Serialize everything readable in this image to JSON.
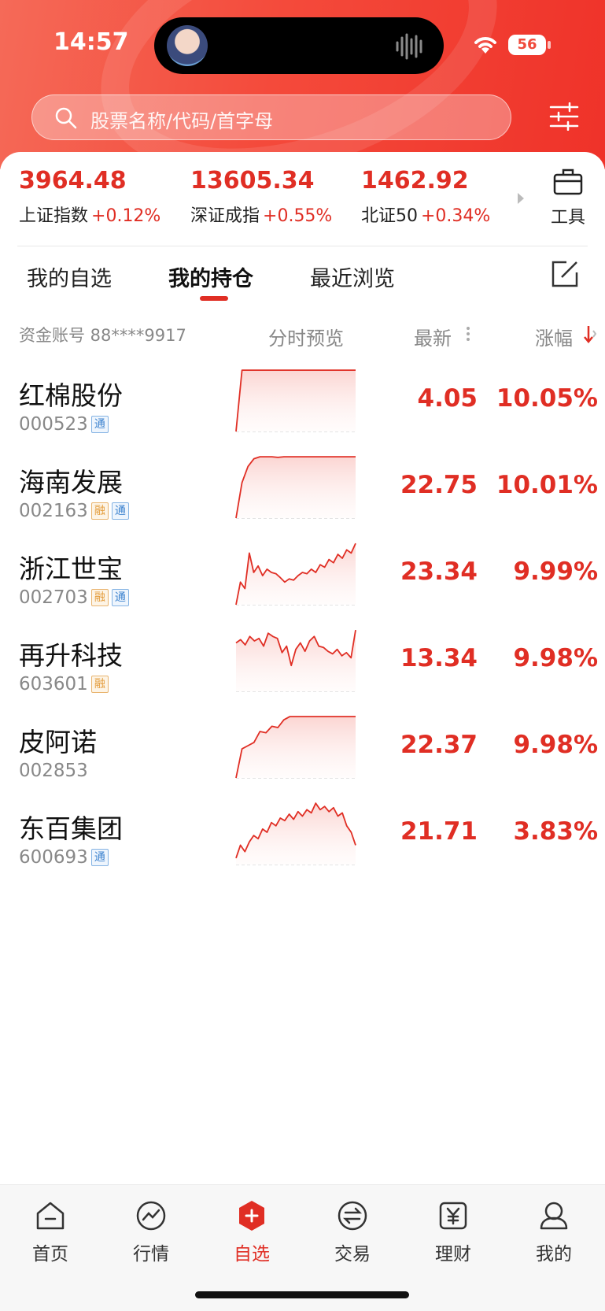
{
  "status_bar": {
    "time": "14:57",
    "battery": "56"
  },
  "search": {
    "placeholder": "股票名称/代码/首字母"
  },
  "indices": [
    {
      "value": "3964.48",
      "name": "上证指数",
      "change": "+0.12%"
    },
    {
      "value": "13605.34",
      "name": "深证成指",
      "change": "+0.55%"
    },
    {
      "value": "1462.92",
      "name": "北证50",
      "change": "+0.34%"
    }
  ],
  "tools": {
    "label": "工具"
  },
  "tabs": [
    {
      "label": "我的自选",
      "active": false
    },
    {
      "label": "我的持仓",
      "active": true
    },
    {
      "label": "最近浏览",
      "active": false
    }
  ],
  "columns": {
    "account": "资金账号 88****9917",
    "preview": "分时预览",
    "latest": "最新",
    "change": "涨幅"
  },
  "holdings": [
    {
      "name": "红棉股份",
      "code": "000523",
      "tags": [
        "通"
      ],
      "price": "4.05",
      "change": "10.05%",
      "trend": [
        0.0,
        0.95,
        0.95,
        0.95,
        0.95,
        0.95,
        0.95,
        0.95,
        0.95,
        0.95,
        0.95,
        0.95,
        0.95,
        0.95,
        0.95,
        0.95,
        0.95,
        0.95,
        0.95,
        0.95,
        0.95
      ]
    },
    {
      "name": "海南发展",
      "code": "002163",
      "tags": [
        "融",
        "通"
      ],
      "price": "22.75",
      "change": "10.01%",
      "trend": [
        0.0,
        0.55,
        0.8,
        0.92,
        0.95,
        0.95,
        0.95,
        0.94,
        0.95,
        0.95,
        0.95,
        0.95,
        0.95,
        0.95,
        0.95,
        0.95,
        0.95,
        0.95,
        0.95,
        0.95,
        0.95
      ]
    },
    {
      "name": "浙江世宝",
      "code": "002703",
      "tags": [
        "融",
        "通"
      ],
      "price": "23.34",
      "change": "9.99%",
      "trend": [
        0.0,
        0.35,
        0.25,
        0.8,
        0.5,
        0.6,
        0.45,
        0.55,
        0.5,
        0.48,
        0.42,
        0.35,
        0.4,
        0.38,
        0.45,
        0.5,
        0.48,
        0.55,
        0.5,
        0.62,
        0.58,
        0.7,
        0.65,
        0.78,
        0.72,
        0.85,
        0.8,
        0.95
      ]
    },
    {
      "name": "再升科技",
      "code": "603601",
      "tags": [
        "融"
      ],
      "price": "13.34",
      "change": "9.98%",
      "trend": [
        0.75,
        0.8,
        0.72,
        0.85,
        0.78,
        0.82,
        0.7,
        0.9,
        0.85,
        0.82,
        0.6,
        0.7,
        0.4,
        0.65,
        0.75,
        0.62,
        0.78,
        0.85,
        0.7,
        0.68,
        0.62,
        0.58,
        0.65,
        0.55,
        0.6,
        0.52,
        0.95
      ]
    },
    {
      "name": "皮阿诺",
      "code": "002853",
      "tags": [],
      "price": "22.37",
      "change": "9.98%",
      "trend": [
        0.0,
        0.45,
        0.5,
        0.55,
        0.72,
        0.7,
        0.8,
        0.78,
        0.9,
        0.95,
        0.95,
        0.95,
        0.95,
        0.95,
        0.95,
        0.95,
        0.95,
        0.95,
        0.95,
        0.95,
        0.95
      ]
    },
    {
      "name": "东百集团",
      "code": "600693",
      "tags": [
        "通"
      ],
      "price": "21.71",
      "change": "3.83%",
      "trend": [
        0.1,
        0.3,
        0.2,
        0.35,
        0.45,
        0.4,
        0.55,
        0.5,
        0.65,
        0.6,
        0.72,
        0.68,
        0.78,
        0.7,
        0.82,
        0.75,
        0.85,
        0.8,
        0.95,
        0.85,
        0.9,
        0.82,
        0.88,
        0.75,
        0.8,
        0.6,
        0.5,
        0.3
      ]
    }
  ],
  "nav": [
    {
      "label": "首页",
      "icon": "home-icon",
      "active": false
    },
    {
      "label": "行情",
      "icon": "market-icon",
      "active": false
    },
    {
      "label": "自选",
      "icon": "watchlist-plus-icon",
      "active": true
    },
    {
      "label": "交易",
      "icon": "trade-icon",
      "active": false
    },
    {
      "label": "理财",
      "icon": "wealth-icon",
      "active": false
    },
    {
      "label": "我的",
      "icon": "profile-icon",
      "active": false
    }
  ],
  "colors": {
    "up": "#e02e24",
    "header": "#f44a3b",
    "tag_rong": "#e39b3a",
    "tag_tong": "#3f84cf"
  }
}
